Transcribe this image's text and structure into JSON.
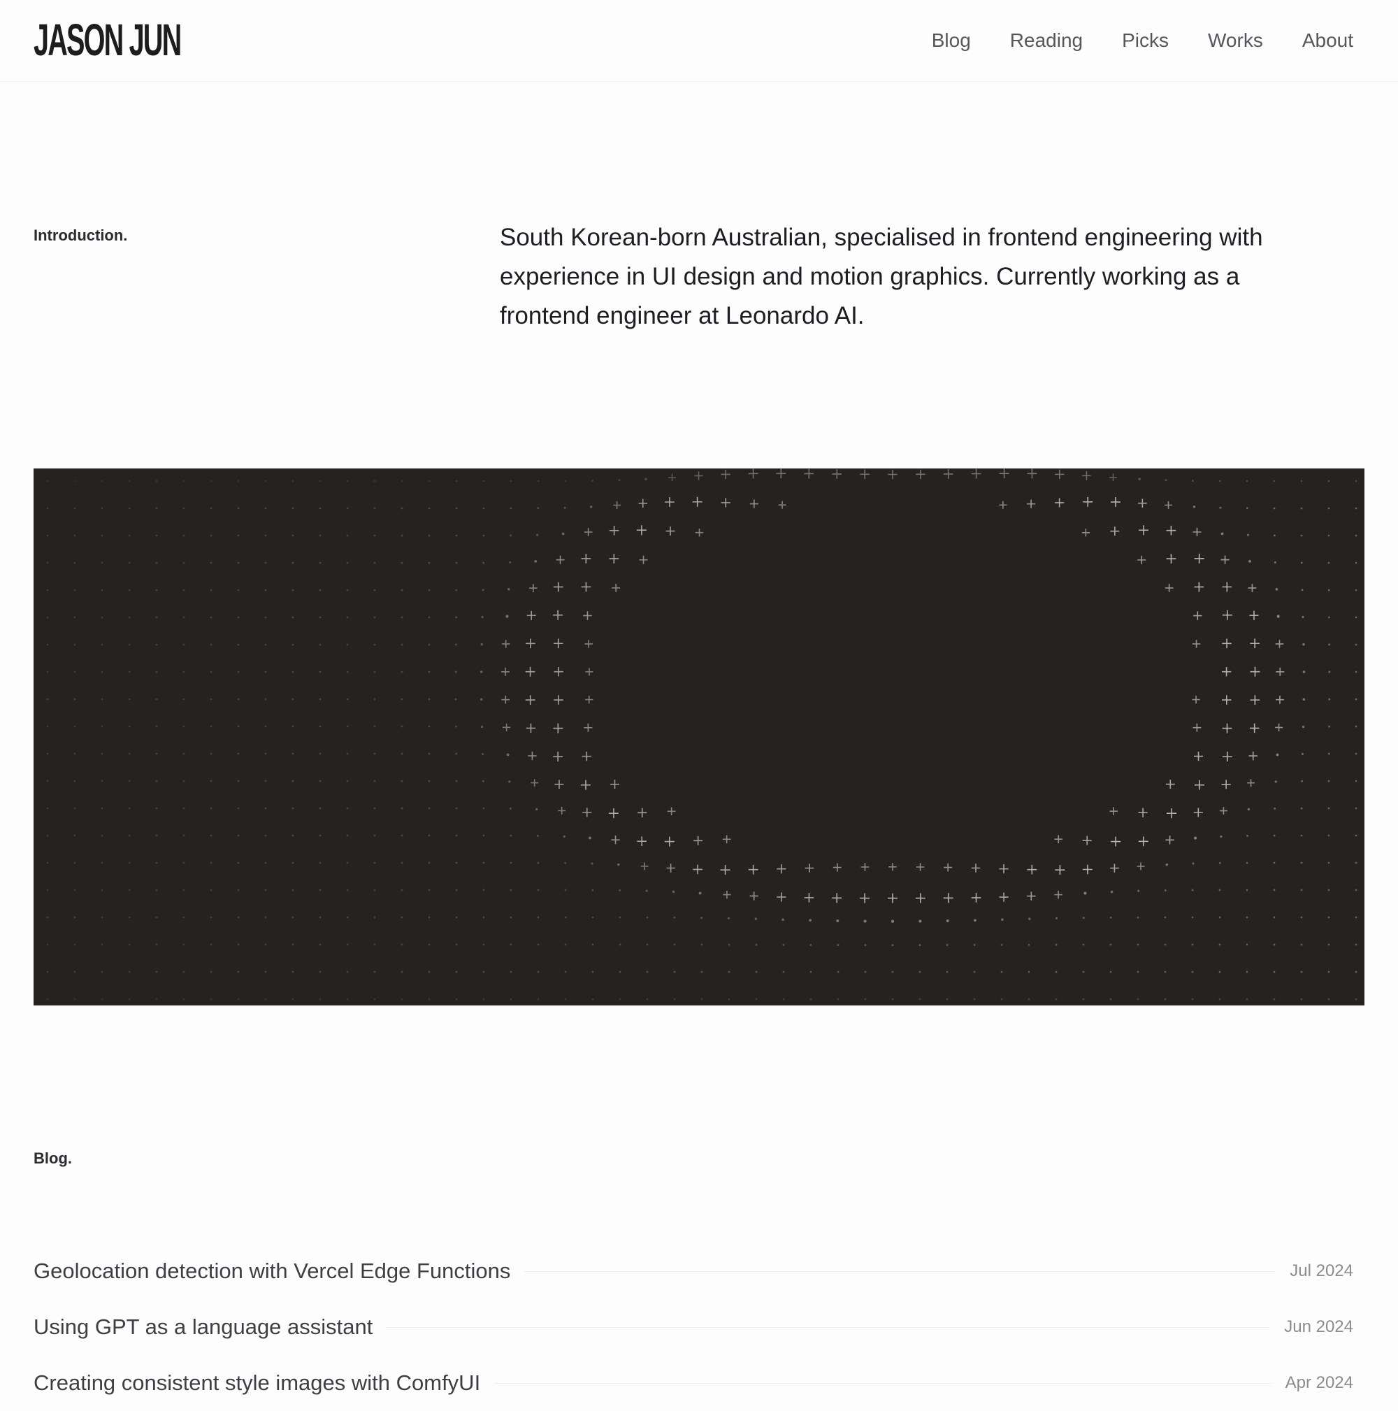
{
  "header": {
    "logo": "JASON JUN",
    "nav": [
      "Blog",
      "Reading",
      "Picks",
      "Works",
      "About"
    ]
  },
  "intro": {
    "label": "Introduction.",
    "text": "South Korean-born Australian, specialised in frontend engineering with experience in UI design and motion graphics. Currently working as a frontend engineer at Leonardo AI."
  },
  "blog": {
    "label": "Blog.",
    "posts": [
      {
        "title": "Geolocation detection with Vercel Edge Functions",
        "date": "Jul 2024"
      },
      {
        "title": "Using GPT as a language assistant",
        "date": "Jun 2024"
      },
      {
        "title": "Creating consistent style images with ComfyUI",
        "date": "Apr 2024"
      }
    ]
  },
  "colors": {
    "hero_background": "#262222",
    "dot": "#bdbab4"
  }
}
